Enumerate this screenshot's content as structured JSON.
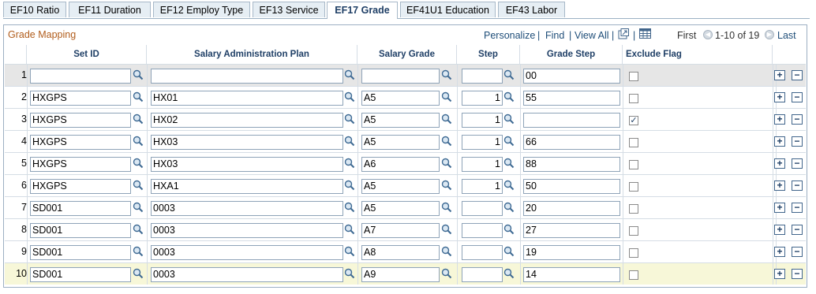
{
  "tabs": [
    {
      "label": "EF10 Ratio",
      "active": false
    },
    {
      "label": "EF11 Duration",
      "active": false
    },
    {
      "label": "EF12 Employ Type",
      "active": false
    },
    {
      "label": "EF13 Service",
      "active": false
    },
    {
      "label": "EF17 Grade",
      "active": true
    },
    {
      "label": "EF41U1 Education",
      "active": false
    },
    {
      "label": "EF43 Labor",
      "active": false
    }
  ],
  "grid": {
    "title": "Grade Mapping",
    "nav": {
      "personalize": "Personalize",
      "find": "Find",
      "view_all": "View All",
      "separator": "|",
      "first": "First",
      "range": "1-10 of 19",
      "last": "Last"
    },
    "columns": {
      "set_id": "Set ID",
      "plan": "Salary Administration Plan",
      "grade": "Salary Grade",
      "step": "Step",
      "grade_step": "Grade Step",
      "exclude": "Exclude Flag"
    },
    "add_symbol": "+",
    "remove_symbol": "−",
    "check_symbol": "✓",
    "rows": [
      {
        "n": "1",
        "set_id": "",
        "plan": "",
        "grade": "",
        "step": "",
        "grade_step": "00",
        "exclude": false
      },
      {
        "n": "2",
        "set_id": "HXGPS",
        "plan": "HX01",
        "grade": "A5",
        "step": "1",
        "grade_step": "55",
        "exclude": false
      },
      {
        "n": "3",
        "set_id": "HXGPS",
        "plan": "HX02",
        "grade": "A5",
        "step": "1",
        "grade_step": "",
        "exclude": true
      },
      {
        "n": "4",
        "set_id": "HXGPS",
        "plan": "HX03",
        "grade": "A5",
        "step": "1",
        "grade_step": "66",
        "exclude": false
      },
      {
        "n": "5",
        "set_id": "HXGPS",
        "plan": "HX03",
        "grade": "A6",
        "step": "1",
        "grade_step": "88",
        "exclude": false
      },
      {
        "n": "6",
        "set_id": "HXGPS",
        "plan": "HXA1",
        "grade": "A5",
        "step": "1",
        "grade_step": "50",
        "exclude": false
      },
      {
        "n": "7",
        "set_id": "SD001",
        "plan": "0003",
        "grade": "A5",
        "step": "",
        "grade_step": "20",
        "exclude": false
      },
      {
        "n": "8",
        "set_id": "SD001",
        "plan": "0003",
        "grade": "A7",
        "step": "",
        "grade_step": "27",
        "exclude": false
      },
      {
        "n": "9",
        "set_id": "SD001",
        "plan": "0003",
        "grade": "A8",
        "step": "",
        "grade_step": "19",
        "exclude": false
      },
      {
        "n": "10",
        "set_id": "SD001",
        "plan": "0003",
        "grade": "A9",
        "step": "",
        "grade_step": "14",
        "exclude": false
      }
    ]
  },
  "icons": {
    "lookup": "magnifier-lookup-icon",
    "zoom": "new-window-icon",
    "download": "download-grid-icon",
    "first": "first-arrow-icon",
    "last": "last-arrow-icon"
  },
  "colors": {
    "title": "#b15d1c",
    "link": "#1f4e79",
    "header_text": "#1f3f66",
    "first_row_bg": "#e6e6e6",
    "last_row_bg": "#f7f7d8"
  }
}
